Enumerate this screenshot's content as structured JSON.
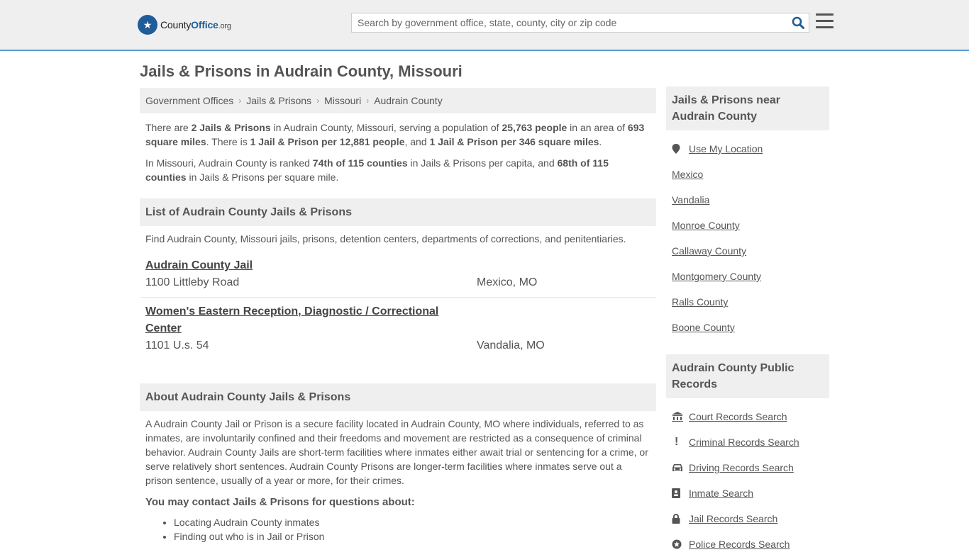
{
  "header": {
    "logo_main": "County",
    "logo_bold": "Office",
    "logo_suffix": ".org",
    "search_placeholder": "Search by government office, state, county, city or zip code"
  },
  "page_title": "Jails & Prisons in Audrain County, Missouri",
  "breadcrumb": [
    "Government Offices",
    "Jails & Prisons",
    "Missouri",
    "Audrain County"
  ],
  "intro": {
    "p1": {
      "t1": "There are ",
      "b1": "2 Jails & Prisons",
      "t2": " in Audrain County, Missouri, serving a population of ",
      "b2": "25,763 people",
      "t3": " in an area of ",
      "b3": "693 square miles",
      "t4": ". There is ",
      "b4": "1 Jail & Prison per 12,881 people",
      "t5": ", and ",
      "b5": "1 Jail & Prison per 346 square miles",
      "t6": "."
    },
    "p2": {
      "t1": "In Missouri, Audrain County is ranked ",
      "b1": "74th of 115 counties",
      "t2": " in Jails & Prisons per capita, and ",
      "b2": "68th of 115 counties",
      "t3": " in Jails & Prisons per square mile."
    }
  },
  "list_section": {
    "heading": "List of Audrain County Jails & Prisons",
    "description": "Find Audrain County, Missouri jails, prisons, detention centers, departments of corrections, and penitentiaries.",
    "items": [
      {
        "name": "Audrain County Jail",
        "address": "1100 Littleby Road",
        "city": "Mexico, MO"
      },
      {
        "name": "Women's Eastern Reception, Diagnostic / Correctional Center",
        "address": "1101 U.s. 54",
        "city": "Vandalia, MO"
      }
    ]
  },
  "about_section": {
    "heading": "About Audrain County Jails & Prisons",
    "body": "A Audrain County Jail or Prison is a secure facility located in Audrain County, MO where individuals, referred to as inmates, are involuntarily confined and their freedoms and movement are restricted as a consequence of criminal behavior. Audrain County Jails are short-term facilities where inmates either await trial or sentencing for a crime, or serve relatively short sentences. Audrain County Prisons are longer-term facilities where inmates serve out a prison sentence, usually of a year or more, for their crimes.",
    "contact_heading": "You may contact Jails & Prisons for questions about:",
    "bullets": [
      "Locating Audrain County inmates",
      "Finding out who is in Jail or Prison"
    ]
  },
  "sidebar": {
    "nearby_heading": "Jails & Prisons near Audrain County",
    "nearby": [
      {
        "label": "Use My Location",
        "icon": "map-pin-icon"
      },
      {
        "label": "Mexico"
      },
      {
        "label": "Vandalia"
      },
      {
        "label": "Monroe County"
      },
      {
        "label": "Callaway County"
      },
      {
        "label": "Montgomery County"
      },
      {
        "label": "Ralls County"
      },
      {
        "label": "Boone County"
      }
    ],
    "records_heading": "Audrain County Public Records",
    "records": [
      {
        "label": "Court Records Search",
        "icon": "courthouse-icon"
      },
      {
        "label": "Criminal Records Search",
        "icon": "exclamation-icon"
      },
      {
        "label": "Driving Records Search",
        "icon": "car-icon"
      },
      {
        "label": "Inmate Search",
        "icon": "id-badge-icon"
      },
      {
        "label": "Jail Records Search",
        "icon": "lock-icon"
      },
      {
        "label": "Police Records Search",
        "icon": "police-icon"
      }
    ]
  }
}
